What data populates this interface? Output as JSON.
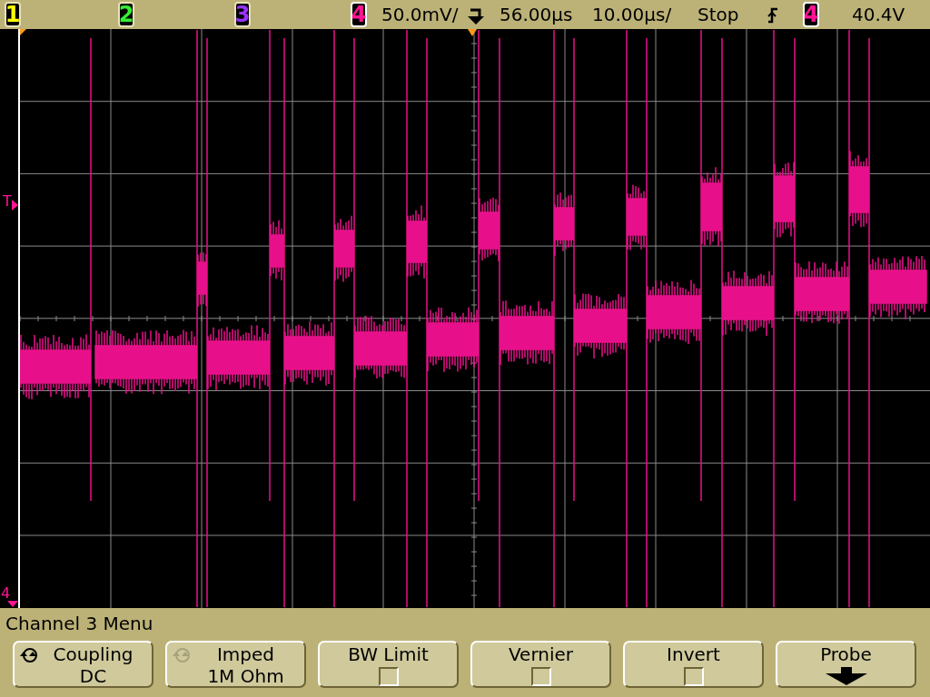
{
  "status_bar": {
    "channels": [
      {
        "label": "1",
        "on": false
      },
      {
        "label": "2",
        "on": false
      },
      {
        "label": "3",
        "on": false
      },
      {
        "label": "4",
        "on": true
      }
    ],
    "volts_per_div": "50.0mV/",
    "delay": "56.00µs",
    "time_per_div": "10.00µs/",
    "run_state": "Stop",
    "trigger_source": {
      "label": "4"
    },
    "trigger_level": "40.4V"
  },
  "display": {
    "trigger_marker": "T",
    "ground_marker": "4"
  },
  "menu": {
    "title": "Channel 3 Menu",
    "softkeys": [
      {
        "kind": "select",
        "label": "Coupling",
        "value": "DC",
        "disabled": false
      },
      {
        "kind": "select",
        "label": "Imped",
        "value": "1M Ohm",
        "disabled": true
      },
      {
        "kind": "checkbox",
        "label": "BW Limit",
        "checked": false
      },
      {
        "kind": "checkbox",
        "label": "Vernier",
        "checked": false
      },
      {
        "kind": "checkbox",
        "label": "Invert",
        "checked": false
      },
      {
        "kind": "submenu",
        "label": "Probe"
      }
    ]
  }
}
